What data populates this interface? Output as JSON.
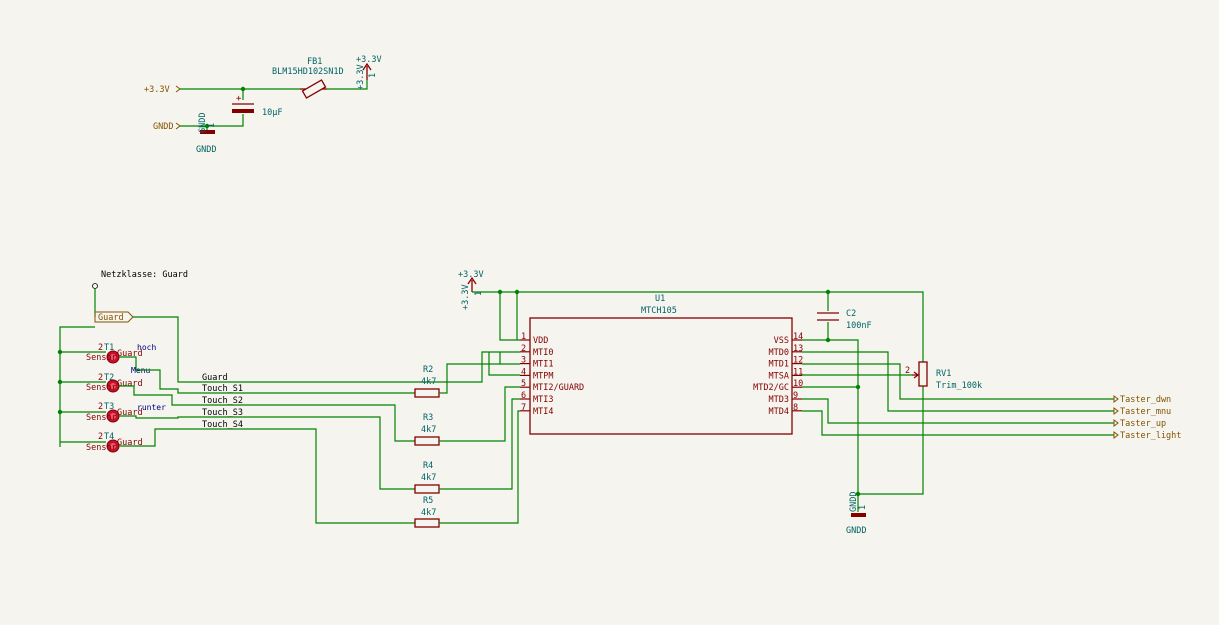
{
  "supply": {
    "fb1": {
      "ref": "FB1",
      "value": "BLM15HD102SN1D"
    },
    "c_bulk": {
      "value": "10µF"
    },
    "pwr_top": "+3.3V",
    "pwr_top_pin": "+3.3V",
    "pwr_top_num": "1",
    "glabel_in_33v": "+3.3V",
    "glabel_in_gndd": "GNDD",
    "gnd_sym": "GNDD",
    "gnd_sym_pin": "GNDD",
    "gnd_sym_num": "1"
  },
  "guard": {
    "note": "Netzklasse: Guard",
    "label": "Guard"
  },
  "sensors": [
    {
      "ref": "T1",
      "pin1": "2",
      "name": "Sensor",
      "net": "Guard",
      "note": "hoch"
    },
    {
      "ref": "T2",
      "pin1": "2",
      "name": "Sensor",
      "net": "Guard",
      "note": "Menu"
    },
    {
      "ref": "T3",
      "pin1": "2",
      "name": "Sensor",
      "net": "Guard",
      "note": "runter"
    },
    {
      "ref": "T4",
      "pin1": "2",
      "name": "Sensor",
      "net": "Guard",
      "note": ""
    }
  ],
  "nets": {
    "guard": "Guard",
    "s1": "Touch_S1",
    "s2": "Touch_S2",
    "s3": "Touch_S3",
    "s4": "Touch_S4"
  },
  "resistors": [
    {
      "ref": "R2",
      "value": "4k7"
    },
    {
      "ref": "R3",
      "value": "4k7"
    },
    {
      "ref": "R4",
      "value": "4k7"
    },
    {
      "ref": "R5",
      "value": "4k7"
    }
  ],
  "u1": {
    "ref": "U1",
    "value": "MTCH105",
    "left_pins": [
      {
        "num": "1",
        "name": "VDD"
      },
      {
        "num": "2",
        "name": "MTI0"
      },
      {
        "num": "3",
        "name": "MTI1"
      },
      {
        "num": "4",
        "name": "MTPM"
      },
      {
        "num": "5",
        "name": "MTI2/GUARD"
      },
      {
        "num": "6",
        "name": "MTI3"
      },
      {
        "num": "7",
        "name": "MTI4"
      }
    ],
    "right_pins": [
      {
        "num": "14",
        "name": "VSS"
      },
      {
        "num": "13",
        "name": "MTD0"
      },
      {
        "num": "12",
        "name": "MTD1"
      },
      {
        "num": "11",
        "name": "MTSA"
      },
      {
        "num": "10",
        "name": "MTD2/GC"
      },
      {
        "num": "9",
        "name": "MTD3"
      },
      {
        "num": "8",
        "name": "MTD4"
      }
    ]
  },
  "pwr_mid": {
    "label": "+3.3V",
    "pin": "+3.3V",
    "num": "1"
  },
  "c2": {
    "ref": "C2",
    "value": "100nF"
  },
  "rv1": {
    "ref": "RV1",
    "value": "Trim_100k",
    "wiper_num": "2"
  },
  "gnd_mid": {
    "label": "GNDD",
    "pin": "GNDD",
    "num": "1"
  },
  "outputs": [
    "Taster_dwn",
    "Taster_mnu",
    "Taster_up",
    "Taster_light"
  ]
}
